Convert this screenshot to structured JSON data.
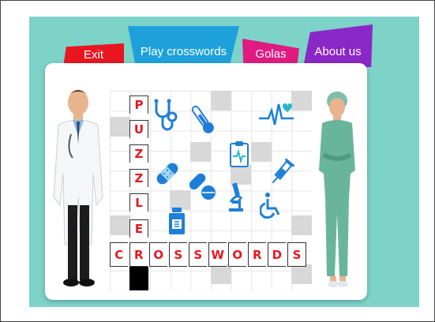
{
  "nav": {
    "exit_label": "Exit",
    "play_label": "Play crosswords",
    "golas_label": "Golas",
    "about_label": "About us"
  },
  "puzzle": {
    "vertical_word": [
      "P",
      "U",
      "Z",
      "Z",
      "L",
      "E"
    ],
    "horizontal_word": [
      "C",
      "R",
      "O",
      "S",
      "S",
      "W",
      "O",
      "R",
      "D",
      "S"
    ]
  },
  "icons": [
    "stethoscope-icon",
    "thermometer-icon",
    "heartbeat-icon",
    "clipboard-icon",
    "bandage-icon",
    "pills-icon",
    "microscope-icon",
    "syringe-icon",
    "medicine-bottle-icon",
    "wheelchair-icon"
  ],
  "colors": {
    "background": "#7dd3c8",
    "exit": "#e8161f",
    "play": "#1ea1db",
    "golas": "#e01a80",
    "about": "#8a27c7",
    "letters": "#e8161f",
    "icons": "#1f7fd6"
  }
}
